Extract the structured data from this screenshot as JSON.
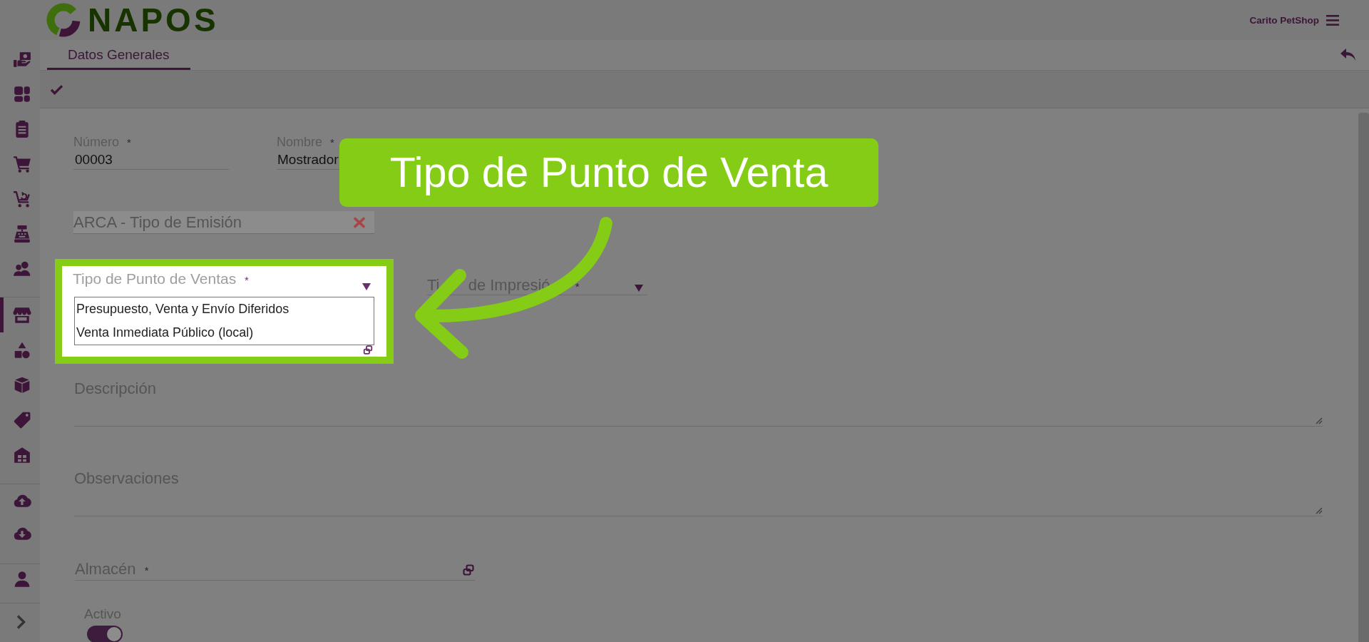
{
  "header": {
    "logo_text": "NAPOS",
    "store_name": "Carito PetShop"
  },
  "sidebar": {
    "groups": [
      {
        "items": [
          {
            "selected": false
          },
          {
            "selected": false
          },
          {
            "selected": false
          },
          {
            "selected": false
          },
          {
            "selected": false
          },
          {
            "selected": false
          },
          {
            "selected": false
          }
        ]
      },
      {
        "items": [
          {
            "selected": true
          },
          {
            "selected": false
          },
          {
            "selected": false
          },
          {
            "selected": false
          },
          {
            "selected": false
          }
        ]
      },
      {
        "items": [
          {
            "selected": false
          },
          {
            "selected": false
          }
        ]
      },
      {
        "items": [
          {
            "selected": false
          }
        ]
      }
    ]
  },
  "tabs": [
    {
      "label": "Datos Generales",
      "selected": true
    }
  ],
  "form": {
    "rows": [
      {
        "fields": [
          {
            "kind": "text",
            "label": "Número",
            "required_mark": "*",
            "value": "00003"
          },
          {
            "kind": "text",
            "label": "Nombre",
            "required_mark": "*",
            "value": "Mostrador"
          }
        ]
      },
      {
        "fields": [
          {
            "kind": "clearable_select",
            "label": "ARCA - Tipo de Emisión",
            "disabled": true
          }
        ]
      },
      {
        "fields": [
          {
            "kind": "open_dropdown",
            "label": "Tipo de Punto de Ventas",
            "required_mark": "*",
            "highlighted": true,
            "options": [
              {
                "label": "Presupuesto, Venta y Envío Diferidos",
                "selected": false
              },
              {
                "label": "Venta Inmediata Público (local)",
                "selected": false
              }
            ]
          },
          {
            "kind": "dropdown",
            "label_parts": [
              "Ti",
              "de Impresió"
            ],
            "required_mark": "*"
          }
        ]
      },
      {
        "fields": [
          {
            "kind": "textarea",
            "label": "Descripción"
          }
        ]
      },
      {
        "fields": [
          {
            "kind": "textarea",
            "label": "Observaciones"
          }
        ]
      },
      {
        "fields": [
          {
            "kind": "lookup",
            "label": "Almacén",
            "required_mark": "*"
          }
        ]
      },
      {
        "fields": [
          {
            "kind": "toggle",
            "label": "Activo",
            "on": true
          }
        ]
      }
    ]
  },
  "callout": {
    "text": "Tipo de Punto de Venta"
  }
}
